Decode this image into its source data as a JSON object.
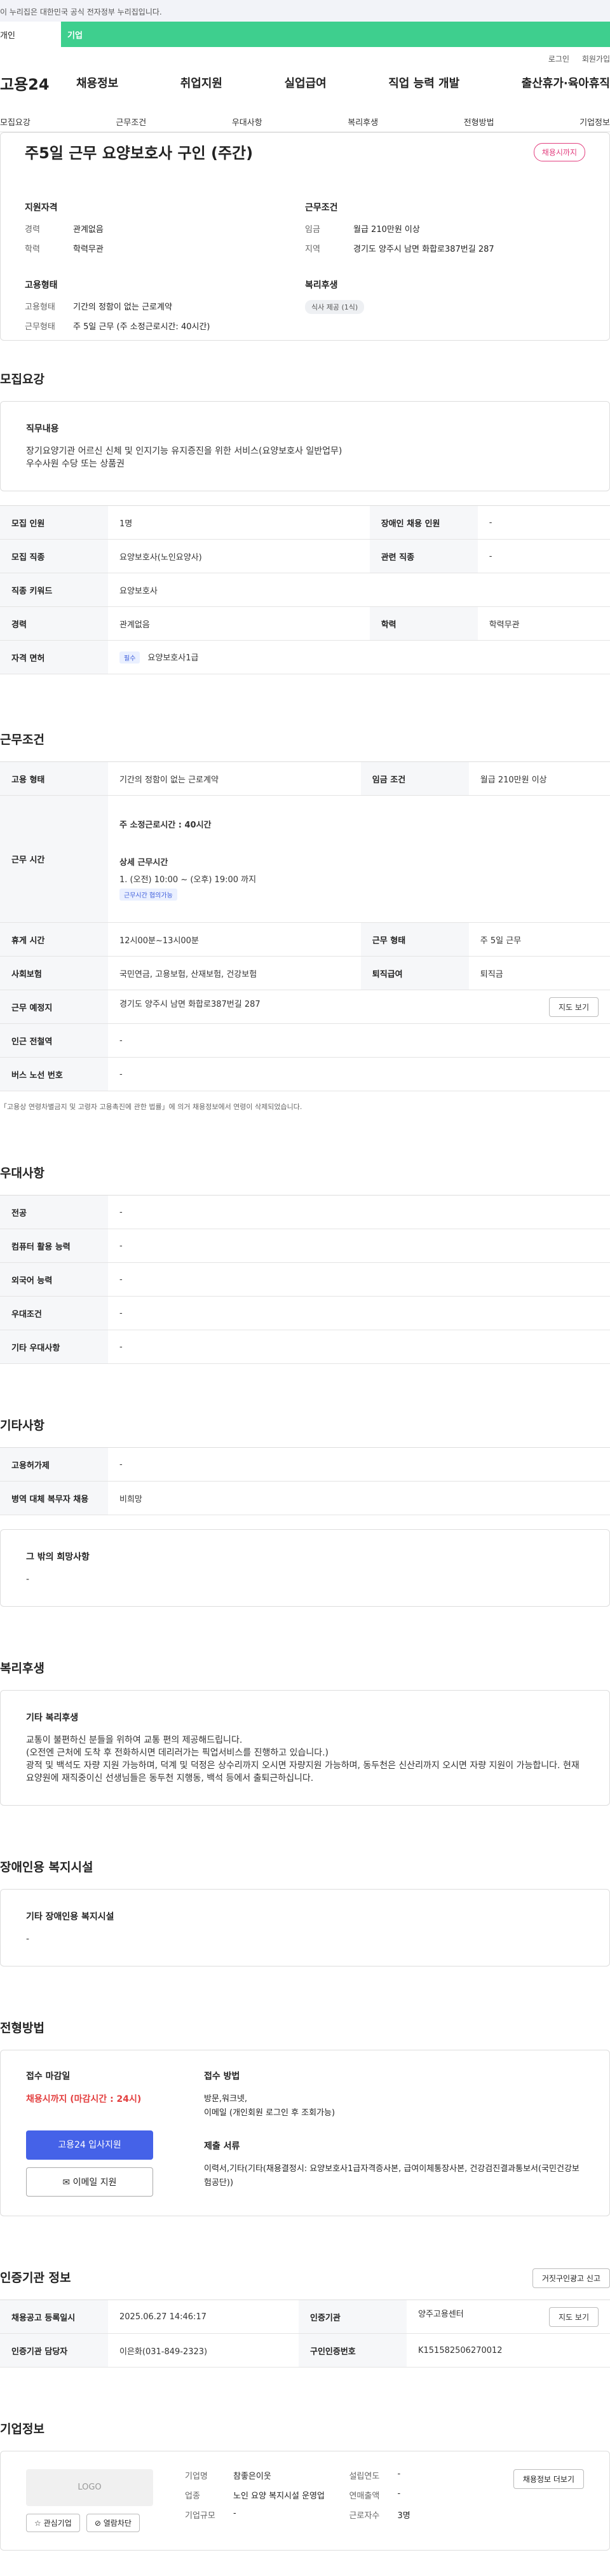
{
  "topbar": {
    "notice": "이 누리집은 대한민국 공식 전자정부 누리집입니다."
  },
  "tabs": {
    "t1": "개인",
    "t2": "기업"
  },
  "util": {
    "login": "로그인",
    "signup": "회원가입"
  },
  "gnb": {
    "logo": "고용24",
    "menu": [
      "채용정보",
      "취업지원",
      "실업급여",
      "직업 능력 개발",
      "출산휴가·육아휴직"
    ]
  },
  "anchors": [
    "모집요강",
    "근무조건",
    "우대사항",
    "복리후생",
    "전형방법",
    "기업정보"
  ],
  "hero": {
    "title": "주5일 근무 요양보호사 구인 (주간)",
    "badge": "채용시까지",
    "qual_title": "지원자격",
    "qual": [
      {
        "k": "경력",
        "v": "관계없음"
      },
      {
        "k": "학력",
        "v": "학력무관"
      }
    ],
    "emp_title": "고용형태",
    "emp": [
      {
        "k": "고용형태",
        "v": "기간의 정함이 없는 근로계약"
      },
      {
        "k": "근무형태",
        "v": "주 5일 근무 (주 소정근로시간: 40시간)"
      }
    ],
    "cond_title": "근무조건",
    "cond": [
      {
        "k": "임금",
        "v": "월급 210만원 이상"
      },
      {
        "k": "지역",
        "v": "경기도 양주시 남면 화합로387번길 287"
      }
    ],
    "welfare_title": "복리후생",
    "welfare_tag": "식사 제공 (1식)"
  },
  "recruit": {
    "title": "모집요강",
    "duty_title": "직무내용",
    "duty_lines": [
      "장기요양기관 어르신 신체 및 인지기능 유지증진을 위한 서비스(요양보호사 일반업무)",
      "우수사원 수당 또는 상품권"
    ],
    "rows": [
      {
        "k1": "모집 인원",
        "v1": "1명",
        "k2": "장애인 채용 인원",
        "v2": "-"
      },
      {
        "k1": "모집 직종",
        "v1": "요양보호사(노인요양사)",
        "k2": "관련 직종",
        "v2": "-"
      },
      {
        "k1": "직종 키워드",
        "v1": "요양보호사",
        "k2": "",
        "v2": ""
      },
      {
        "k1": "경력",
        "v1": "관계없음",
        "k2": "학력",
        "v2": "학력무관"
      }
    ],
    "license_k": "자격 면허",
    "license_tag": "필수",
    "license_v": "요양보호사1급"
  },
  "work": {
    "title": "근무조건",
    "emp_k": "고용 형태",
    "emp_v": "기간의 정함이 없는 근로계약",
    "wage_k": "임금 조건",
    "wage_v": "월급 210만원 이상",
    "time_k": "근무 시간",
    "time_main": "주 소정근로시간 : 40시간",
    "time_detail_title": "상세 근무시간",
    "time_detail": "1. (오전) 10:00 ~ (오후) 19:00 까지",
    "time_tag": "근무시간 협의가능",
    "rest_k": "휴게 시간",
    "rest_v": "12시00분~13시00분",
    "type_k": "근무 형태",
    "type_v": "주 5일 근무",
    "ins_k": "사회보험",
    "ins_v": "국민연금, 고용보험, 산재보험, 건강보험",
    "ret_k": "퇴직급여",
    "ret_v": "퇴직금",
    "place_k": "근무 예정지",
    "place_v": "경기도 양주시 남면 화합로387번길 287",
    "map_btn": "지도 보기",
    "subway_k": "인근 전철역",
    "subway_v": "-",
    "bus_k": "버스 노선 번호",
    "bus_v": "-",
    "note": "「고용상 연령차별금지 및 고령자 고용촉진에 관한 법률」에 의거 채용정보에서 연령이 삭제되었습니다."
  },
  "pref": {
    "title": "우대사항",
    "rows": [
      {
        "k": "전공",
        "v": "-"
      },
      {
        "k": "컴퓨터 활용 능력",
        "v": "-"
      },
      {
        "k": "외국어 능력",
        "v": "-"
      },
      {
        "k": "우대조건",
        "v": "-"
      },
      {
        "k": "기타 우대사항",
        "v": "-"
      }
    ]
  },
  "etc": {
    "title": "기타사항",
    "rows": [
      {
        "k": "고용허가제",
        "v": "-"
      },
      {
        "k": "병역 대체 복무자 채용",
        "v": "비희망"
      }
    ],
    "other_title": "그 밖의 희망사항",
    "other_v": "-"
  },
  "welfare": {
    "title": "복리후생",
    "box_title": "기타 복리후생",
    "lines": [
      "교통이 불편하신 분들을 위하여 교통 편의 제공해드립니다.",
      "(오전엔 근처에 도착 후 전화하시면 데리러가는 픽업서비스를 진행하고 있습니다.)",
      "광적 및 백석도 자량 지원 가능하며, 덕계 및 덕정은 상수리까지 오시면 자량지원 가능하며, 동두천은 신산리까지 오시면 자량 지원이 가능합니다. 현재 요양원에 재직중이신 선생님들은 동두천 지행동, 백석 등에서 출퇴근하십니다."
    ]
  },
  "disability": {
    "title": "장애인용 복지시설",
    "box_title": "기타 장애인용 복지시설",
    "v": "-"
  },
  "process": {
    "title": "전형방법",
    "deadline_title": "접수 마감일",
    "deadline_v": "채용시까지 (마감시간 : 24시)",
    "apply_btn": "고용24 입사지원",
    "email_btn": "이메일 지원",
    "method_title": "접수 방법",
    "method_v": "방문,워크넷,\n이메일 (개인회원 로그인 후 조회가능)",
    "docs_title": "제출 서류",
    "docs_v": "이력서,기타(기타(채용결정시: 요양보호사1급자격증사본, 급여이체통장사본, 건강검진결과통보서(국민건강보험공단))"
  },
  "cert": {
    "title": "인증기관 정보",
    "report_btn": "거짓구인광고 신고",
    "rows": [
      {
        "k1": "채용공고 등록일시",
        "v1": "2025.06.27 14:46:17",
        "k2": "인증기관",
        "v2": "양주고용센터",
        "btn": "지도 보기"
      },
      {
        "k1": "인증기관 담당자",
        "v1": "이은화(031-849-2323)",
        "k2": "구인인증번호",
        "v2": "K151582506270012",
        "btn": ""
      }
    ]
  },
  "company": {
    "title": "기업정보",
    "logo": "LOGO",
    "fav_btn": "관심기업",
    "block_btn": "열람차단",
    "info": [
      {
        "k": "기업명",
        "v": "참좋은이웃"
      },
      {
        "k": "업종",
        "v": "노인 요양 복지시설 운영업"
      },
      {
        "k": "기업규모",
        "v": "-"
      }
    ],
    "info2": [
      {
        "k": "설립연도",
        "v": "-"
      },
      {
        "k": "연매출액",
        "v": "-"
      },
      {
        "k": "근로자수",
        "v": "3명"
      }
    ],
    "more_btn": "채용정보 더보기"
  }
}
